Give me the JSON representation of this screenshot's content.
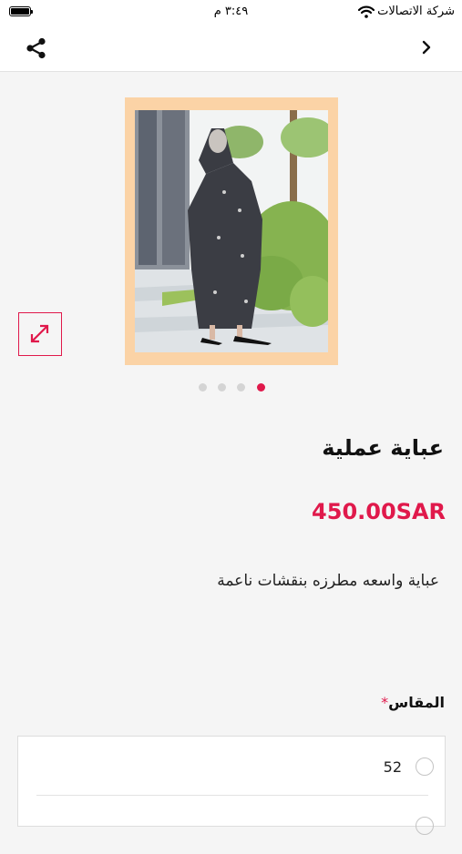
{
  "status_bar": {
    "carrier": "شركة الاتصالات",
    "time": "٣:٤٩ م",
    "wifi_icon": "wifi-icon",
    "battery_icon": "battery-icon"
  },
  "nav": {
    "back_icon": "chevron-right-icon",
    "share_icon": "share-icon"
  },
  "gallery": {
    "image_count": 4,
    "active_index": 3,
    "frame_color": "#fbd3a6",
    "expand_icon": "expand-arrows-icon"
  },
  "product": {
    "title": "عباية عملية",
    "price": "450.00SAR",
    "description": "عباية واسعه مطرزه بنقشات ناعمة"
  },
  "size": {
    "label": "المقاس",
    "required_mark": "*",
    "options": [
      {
        "label": "52"
      },
      {
        "label": ""
      }
    ]
  },
  "colors": {
    "accent": "#e0194b",
    "background": "#f5f5f5"
  }
}
